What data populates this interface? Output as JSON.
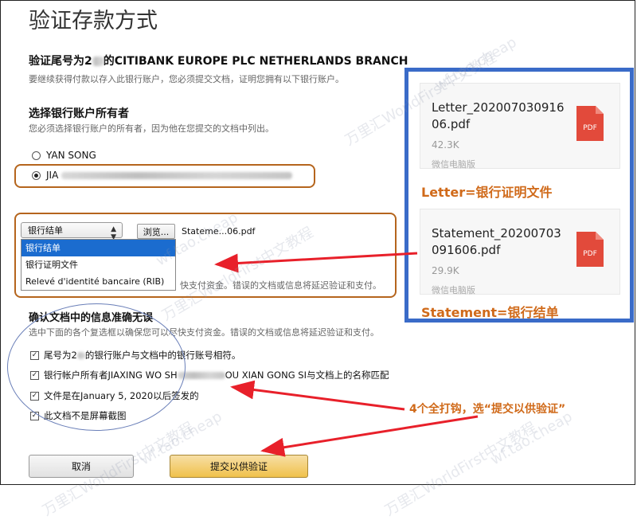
{
  "page": {
    "title": "验证存款方式"
  },
  "account_section": {
    "heading_prefix": "验证尾号为2",
    "heading_suffix": "的CITIBANK EUROPE PLC NETHERLANDS BRANCH",
    "description": "要继续获得付款以存入此银行账户，您必须提交文档，证明您拥有以下银行账户。"
  },
  "owner_section": {
    "heading": "选择银行账户所有者",
    "description": "您必须选择银行账户的所有者，因为他在您提交的文档中列出。",
    "options": [
      {
        "label": "YAN SONG",
        "selected": false
      },
      {
        "label": "JIA",
        "selected": true
      }
    ]
  },
  "document_section": {
    "select_value": "银行结单",
    "browse_label": "浏览...",
    "filename": "Stateme...06.pdf",
    "dropdown_options": [
      "银行结单",
      "银行证明文件",
      "Relevé d'identité bancaire (RIB)"
    ],
    "partial_note": "快支付资金。错误的文档或信息将延迟验证和支付。"
  },
  "confirm_section": {
    "heading": "确认文档中的信息准确无误",
    "description": "选中下面的各个复选框以确保您可以尽快支付资金。错误的文档或信息将延迟验证和支付。",
    "checks": [
      {
        "prefix": "尾号为2",
        "suffix": "的银行账户与文档中的银行账号相符。"
      },
      {
        "prefix": "银行帐户所有者JIAXING WO SH",
        "suffix": "OU XIAN GONG SI与文档上的名称匹配"
      },
      {
        "prefix": "文件是在January 5, 2020以后签发的",
        "suffix": ""
      },
      {
        "prefix": "此文档不是屏幕截图",
        "suffix": ""
      }
    ],
    "check_mark": "✓"
  },
  "buttons": {
    "cancel": "取消",
    "submit": "提交以供验证"
  },
  "files_panel": {
    "files": [
      {
        "name": "Letter_20200703091606.pdf",
        "size": "42.3K",
        "source": "微信电脑版",
        "icon": "pdf-icon",
        "icon_label": "PDF"
      },
      {
        "name": "Statement_20200703091606.pdf",
        "size": "29.9K",
        "source": "微信电脑版",
        "icon": "pdf-icon",
        "icon_label": "PDF"
      }
    ],
    "labels": [
      "Letter=银行证明文件",
      "Statement=银行结单"
    ]
  },
  "annotation": {
    "note": "4个全打钩，选“提交以供验证”"
  },
  "watermark": {
    "line1": "万里汇WorldFirst中文教程",
    "line2": "wf.tao.cheap"
  },
  "colors": {
    "accent_orange": "#d06a1a",
    "panel_blue": "#3a6bc8",
    "arrow_red": "#e8202a",
    "submit_yellow": "#f0c14b"
  }
}
